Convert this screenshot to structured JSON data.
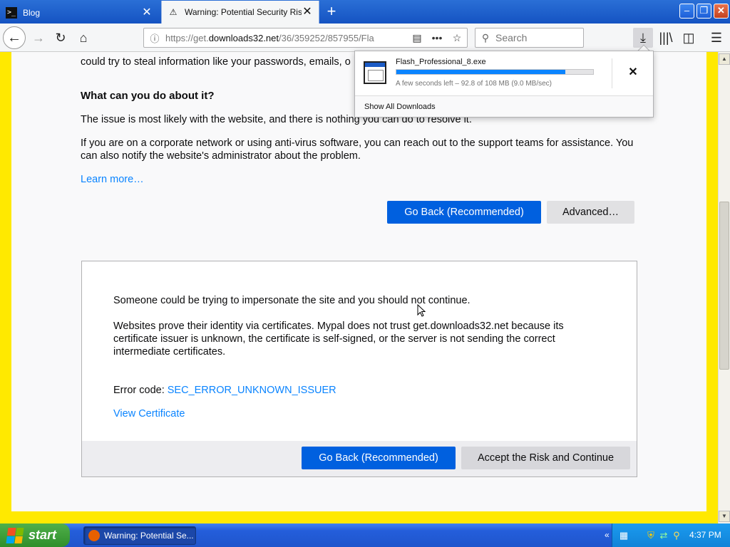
{
  "browser": {
    "tabs": [
      {
        "label": "Blog",
        "active": false,
        "icon": "terminal-icon"
      },
      {
        "label": "Warning: Potential Security Risk Ah",
        "active": true,
        "icon": "warning-icon"
      }
    ],
    "url_prefix": "https://get.",
    "url_domain": "downloads32.net",
    "url_path": "/36/359252/857955/Fla",
    "search_placeholder": "Search",
    "icons": {
      "back": "back-arrow-icon",
      "forward": "forward-arrow-icon",
      "reload": "reload-icon",
      "home": "home-icon",
      "download": "download-icon",
      "library": "library-icon",
      "sidebar": "sidebar-icon",
      "menu": "hamburger-menu-icon"
    }
  },
  "page": {
    "cut_text": "could try to steal information like your passwords, emails, o",
    "what_heading": "What can you do about it?",
    "issue_text": "The issue is most likely with the website, and there is nothing you can do to resolve it.",
    "corp_text": "If you are on a corporate network or using anti-virus software, you can reach out to the support teams for assistance. You can also notify the website's administrator about the problem.",
    "learn_more": "Learn more…",
    "go_back_label": "Go Back (Recommended)",
    "advanced_label": "Advanced…",
    "advanced_panel": {
      "impersonate_text": "Someone could be trying to impersonate the site and you should not continue.",
      "websites_text": "Websites prove their identity via certificates. Mypal does not trust get.downloads32.net because its certificate issuer is unknown, the certificate is self-signed, or the server is not sending the correct intermediate certificates.",
      "error_code_label": "Error code: ",
      "error_code": "SEC_ERROR_UNKNOWN_ISSUER",
      "view_certificate": "View Certificate",
      "go_back_label": "Go Back (Recommended)",
      "accept_label": "Accept the Risk and Continue"
    }
  },
  "downloads": {
    "filename": "Flash_Professional_8.exe",
    "progress": 0.86,
    "status": "A few seconds left – 92.8 of 108 MB (9.0 MB/sec)",
    "show_all": "Show All Downloads"
  },
  "taskbar": {
    "start_label": "start",
    "task_label": "Warning: Potential Se...",
    "clock": "4:37 PM"
  },
  "colors": {
    "warning_border": "#ffe900",
    "primary_button": "#0060df",
    "link": "#0a84ff"
  }
}
